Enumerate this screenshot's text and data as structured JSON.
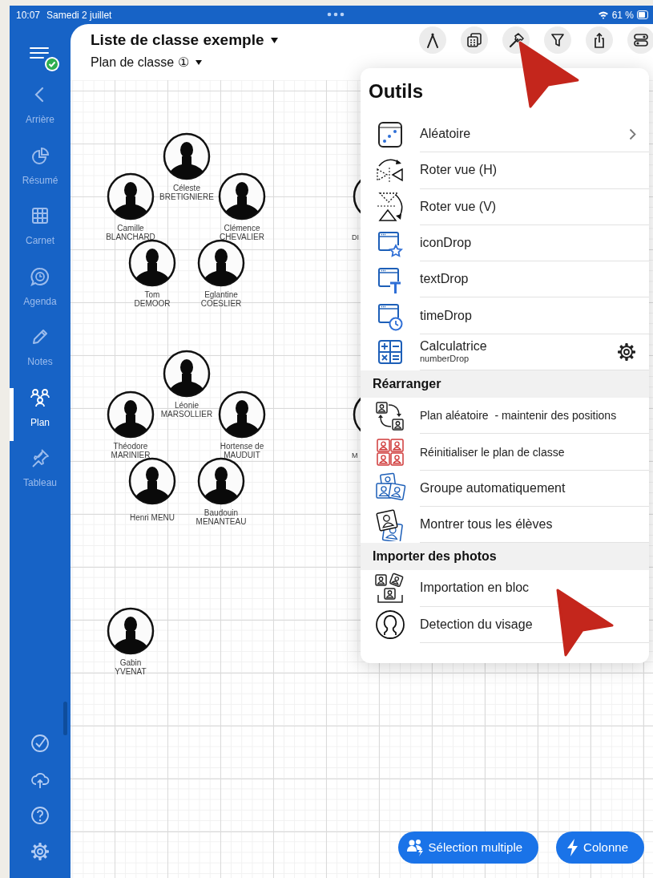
{
  "status_bar": {
    "time": "10:07",
    "date": "Samedi 2 juillet",
    "battery": "61 %"
  },
  "sidebar": {
    "items": [
      {
        "label": "Arrière",
        "selected": false
      },
      {
        "label": "Résumé",
        "selected": false
      },
      {
        "label": "Carnet",
        "selected": false
      },
      {
        "label": "Agenda",
        "selected": false
      },
      {
        "label": "Notes",
        "selected": false
      },
      {
        "label": "Plan",
        "selected": true
      },
      {
        "label": "Tableau",
        "selected": false
      }
    ]
  },
  "header": {
    "title": "Liste de classe exemple",
    "subtitle": "Plan de classe ①"
  },
  "students": [
    {
      "lines": [
        "Céleste",
        "BRETIGNIERE"
      ],
      "kind": "full"
    },
    {
      "lines": [
        "Camille",
        "BLANCHARD"
      ],
      "kind": "full"
    },
    {
      "lines": [
        "Clémence",
        "CHEVALIER"
      ],
      "kind": "full"
    },
    {
      "lines": [
        "Tom",
        "DEMOOR"
      ],
      "kind": "full"
    },
    {
      "lines": [
        "Eglantine",
        "COESLIER"
      ],
      "kind": "full"
    },
    {
      "lines": [
        "Léonie",
        "MARSOLLIER"
      ],
      "kind": "full"
    },
    {
      "lines": [
        "Théodore",
        "MARINIER"
      ],
      "kind": "full"
    },
    {
      "lines": [
        "Hortense de",
        "MAUDUIT"
      ],
      "kind": "full"
    },
    {
      "lines": [
        "Henri MENU"
      ],
      "kind": "full"
    },
    {
      "lines": [
        "Baudouin",
        "MENANTEAU"
      ],
      "kind": "full"
    },
    {
      "lines": [
        "Gabin",
        "YVENAT"
      ],
      "kind": "full"
    },
    {
      "lines": [
        "DI"
      ],
      "kind": "partial"
    },
    {
      "lines": [
        "M"
      ],
      "kind": "partial"
    }
  ],
  "tools_menu": {
    "title": "Outils",
    "items": [
      {
        "label": "Aléatoire",
        "kind": "submenu"
      },
      {
        "label": "Roter vue (H)"
      },
      {
        "label": "Roter vue (V)"
      },
      {
        "label": "iconDrop"
      },
      {
        "label": "textDrop"
      },
      {
        "label": "timeDrop"
      },
      {
        "label": "Calculatrice",
        "subtitle": "numberDrop",
        "kind": "configurable"
      }
    ],
    "sections": [
      {
        "header": "Réarranger",
        "items": [
          {
            "label": "Plan aléatoire  - maintenir des positions"
          },
          {
            "label": "Réinitialiser le plan de classe"
          },
          {
            "label": "Groupe automatiquement"
          },
          {
            "label": "Montrer tous les élèves"
          }
        ]
      },
      {
        "header": "Importer des photos",
        "items": [
          {
            "label": "Importation en bloc"
          },
          {
            "label": "Detection du visage"
          }
        ]
      }
    ]
  },
  "actions": [
    {
      "label": "Sélection multiple"
    },
    {
      "label": "Colonne"
    }
  ]
}
